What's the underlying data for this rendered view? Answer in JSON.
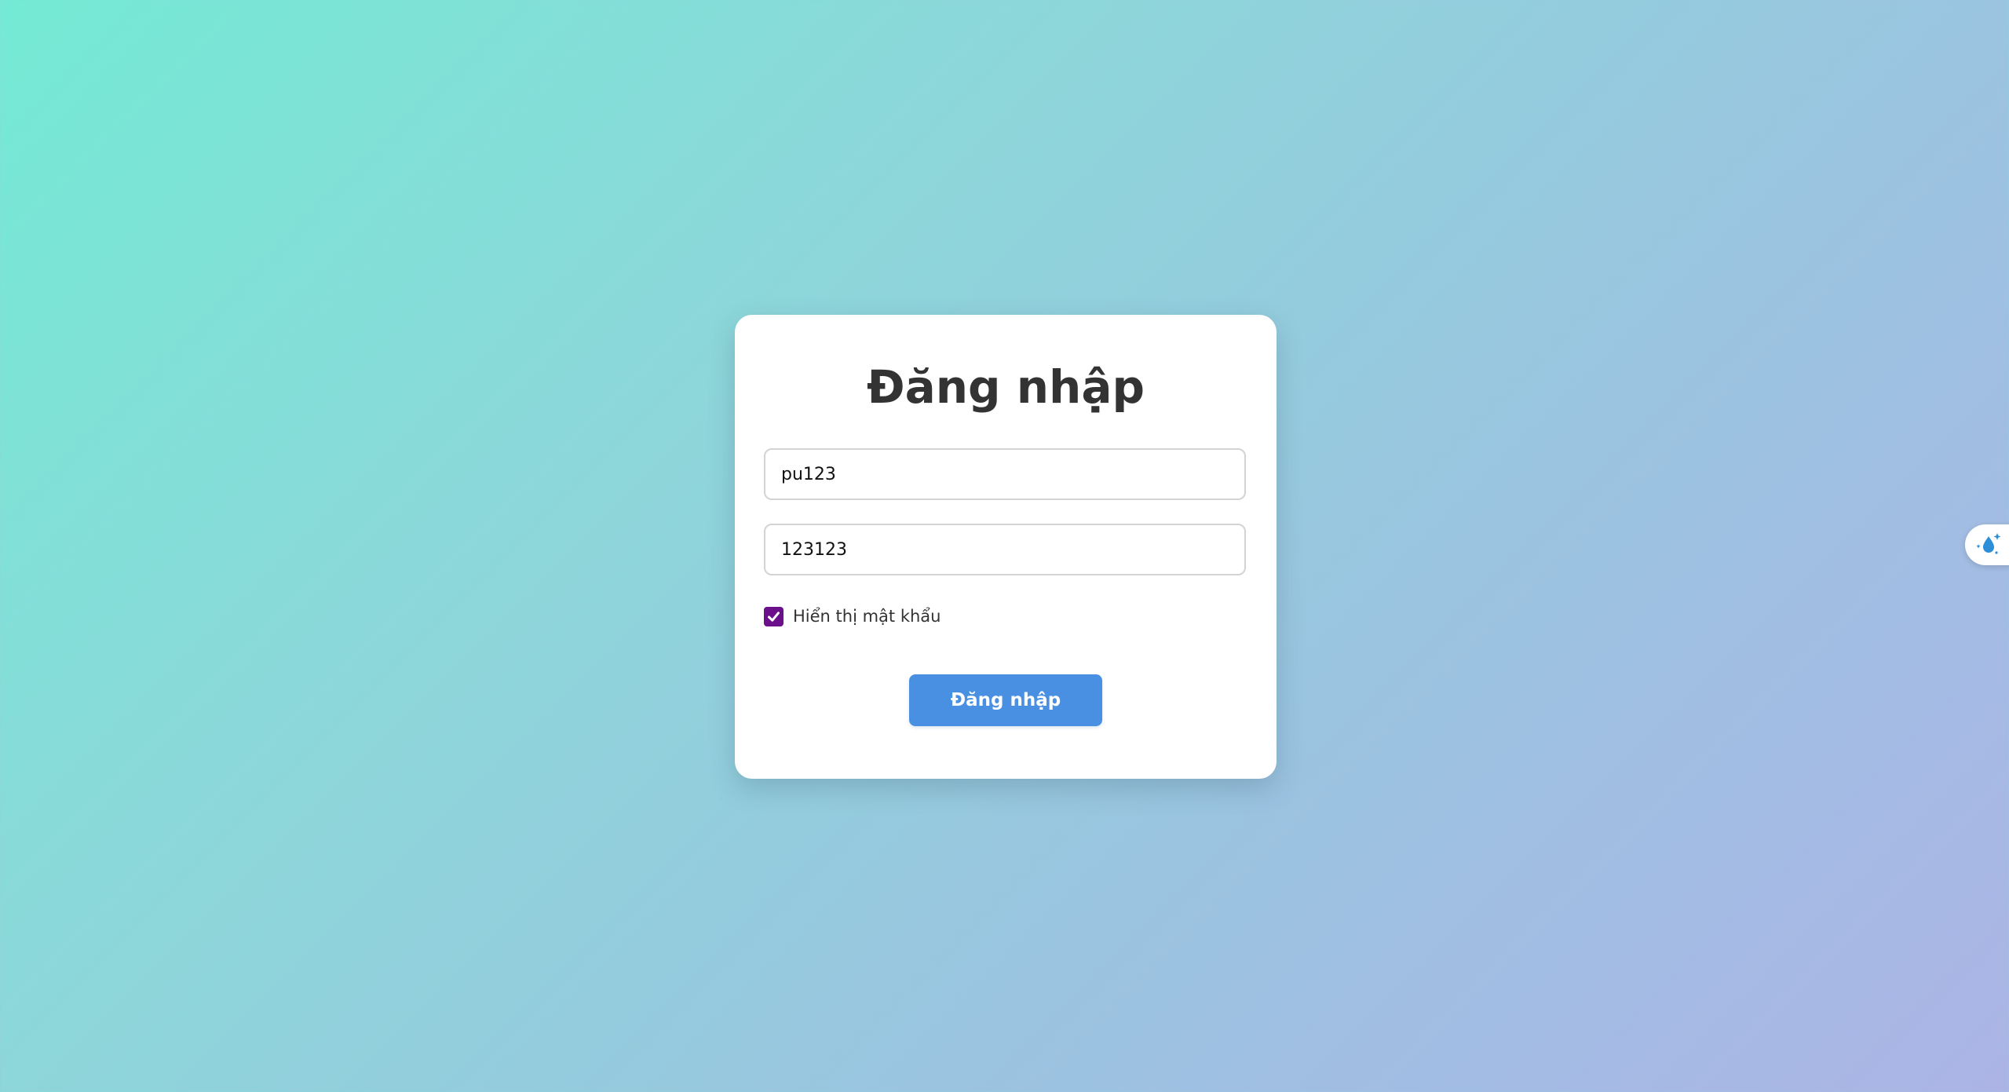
{
  "login": {
    "title": "Đăng nhập",
    "username_value": "pu123",
    "password_value": "123123",
    "show_password_label": "Hiển thị mật khẩu",
    "show_password_checked": true,
    "submit_label": "Đăng nhập"
  },
  "colors": {
    "background_start": "#74ead4",
    "background_end": "#acb4e6",
    "button": "#4a90e2",
    "checkbox": "#6b0f8a",
    "title_text": "#333333"
  },
  "side_widget": {
    "icon": "water-drop-sparkle-icon"
  }
}
